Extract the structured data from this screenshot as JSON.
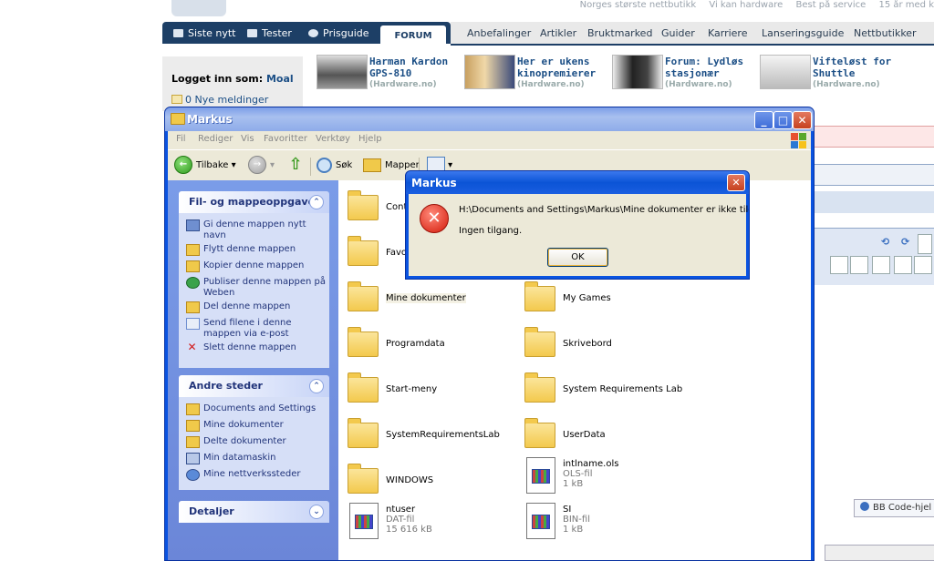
{
  "site": {
    "top_links": [
      "Norges største nettbutikk",
      "Vi kan hardware",
      "Best på service",
      "15 år med k"
    ],
    "nav_dark": [
      {
        "label": "Siste nytt"
      },
      {
        "label": "Tester"
      },
      {
        "label": "Prisguide"
      }
    ],
    "forum_tab": "FORUM",
    "nav_light": [
      "Anbefalinger",
      "Artikler",
      "Bruktmarked",
      "Guider",
      "Karriere",
      "Lanseringsguide",
      "Nettbutikker"
    ],
    "logged_in_label": "Logget inn som:",
    "username": "Moal",
    "new_messages": "0 Nye meldinger",
    "news": [
      {
        "title": "Harman Kardon GPS-810",
        "source": "(Hardware.no)"
      },
      {
        "title": "Her er ukens kinopremierer",
        "source": "(Hardware.no)"
      },
      {
        "title": "Forum: Lydløs stasjonær",
        "source": "(Hardware.no)"
      },
      {
        "title": "Vifteløst for Shuttle",
        "source": "(Hardware.no)"
      }
    ],
    "bb_code_button": "BB Code-hjel"
  },
  "explorer": {
    "title": "Markus",
    "menu": [
      "Fil",
      "Rediger",
      "Vis",
      "Favoritter",
      "Verktøy",
      "Hjelp"
    ],
    "toolbar": {
      "back": "Tilbake",
      "search": "Søk",
      "folders": "Mapper"
    },
    "task_pane": {
      "file_tasks": {
        "title": "Fil- og mappeoppgaver",
        "items": [
          "Gi denne mappen nytt navn",
          "Flytt denne mappen",
          "Kopier denne mappen",
          "Publiser denne mappen på Weben",
          "Del denne mappen",
          "Send filene i denne mappen via e-post",
          "Slett denne mappen"
        ]
      },
      "other_places": {
        "title": "Andre steder",
        "items": [
          "Documents and Settings",
          "Mine dokumenter",
          "Delte dokumenter",
          "Min datamaskin",
          "Mine nettverkssteder"
        ]
      },
      "details": {
        "title": "Detaljer"
      }
    },
    "items": [
      {
        "name": "Conte",
        "kind": "folder"
      },
      {
        "name": "Favor",
        "kind": "folder"
      },
      {
        "name": "Mine dokumenter",
        "kind": "folder"
      },
      {
        "name": "My Games",
        "kind": "folder"
      },
      {
        "name": "Programdata",
        "kind": "folder"
      },
      {
        "name": "Skrivebord",
        "kind": "folder"
      },
      {
        "name": "Start-meny",
        "kind": "folder"
      },
      {
        "name": "System Requirements Lab",
        "kind": "folder"
      },
      {
        "name": "SystemRequirementsLab",
        "kind": "folder"
      },
      {
        "name": "UserData",
        "kind": "folder"
      },
      {
        "name": "WINDOWS",
        "kind": "folder"
      },
      {
        "name": "intlname.ols",
        "kind": "file",
        "type": "OLS-fil",
        "size": "1 kB"
      },
      {
        "name": "ntuser",
        "kind": "file",
        "type": "DAT-fil",
        "size": "15 616 kB"
      },
      {
        "name": "SI",
        "kind": "file",
        "type": "BIN-fil",
        "size": "1 kB"
      }
    ]
  },
  "dialog": {
    "title": "Markus",
    "message": "H:\\Documents and Settings\\Markus\\Mine dokumenter er ikke tilgjengelig.",
    "detail": "Ingen tilgang.",
    "ok_label": "OK"
  },
  "colors": {
    "xp_blue": "#0a53e0",
    "task_pane_blue": "#6b86d8",
    "site_navy": "#1d3f66",
    "error_red": "#d41a0a"
  }
}
